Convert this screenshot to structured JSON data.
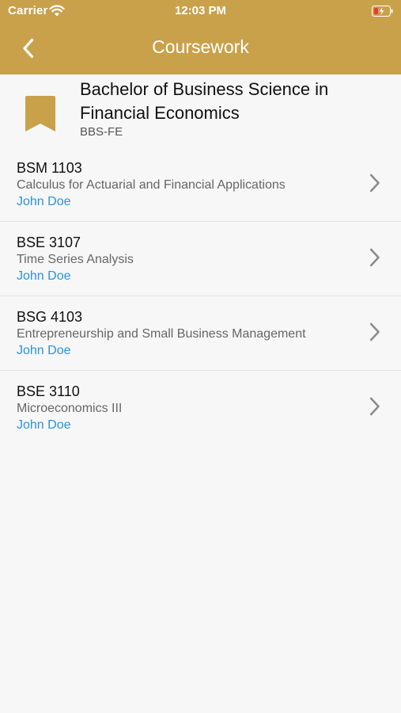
{
  "status": {
    "carrier": "Carrier",
    "time": "12:03 PM"
  },
  "nav": {
    "title": "Coursework",
    "back_icon": "chevron-left-icon",
    "right_icon": "moon-icon"
  },
  "program": {
    "title": "Bachelor of Business Science in Financial Economics",
    "code": "BBS-FE",
    "icon": "bookmark-icon"
  },
  "courses": [
    {
      "code": "BSM 1103",
      "name": "Calculus for Actuarial and Financial Applications",
      "lecturer": "John Doe"
    },
    {
      "code": "BSE 3107",
      "name": "Time Series Analysis",
      "lecturer": "John Doe"
    },
    {
      "code": "BSG 4103",
      "name": "Entrepreneurship and Small Business Management",
      "lecturer": "John Doe"
    },
    {
      "code": "BSE 3110",
      "name": "Microeconomics III",
      "lecturer": "John Doe"
    }
  ],
  "colors": {
    "header": "#c9a14a",
    "link": "#2a93e0",
    "background": "#f7f7f7"
  }
}
